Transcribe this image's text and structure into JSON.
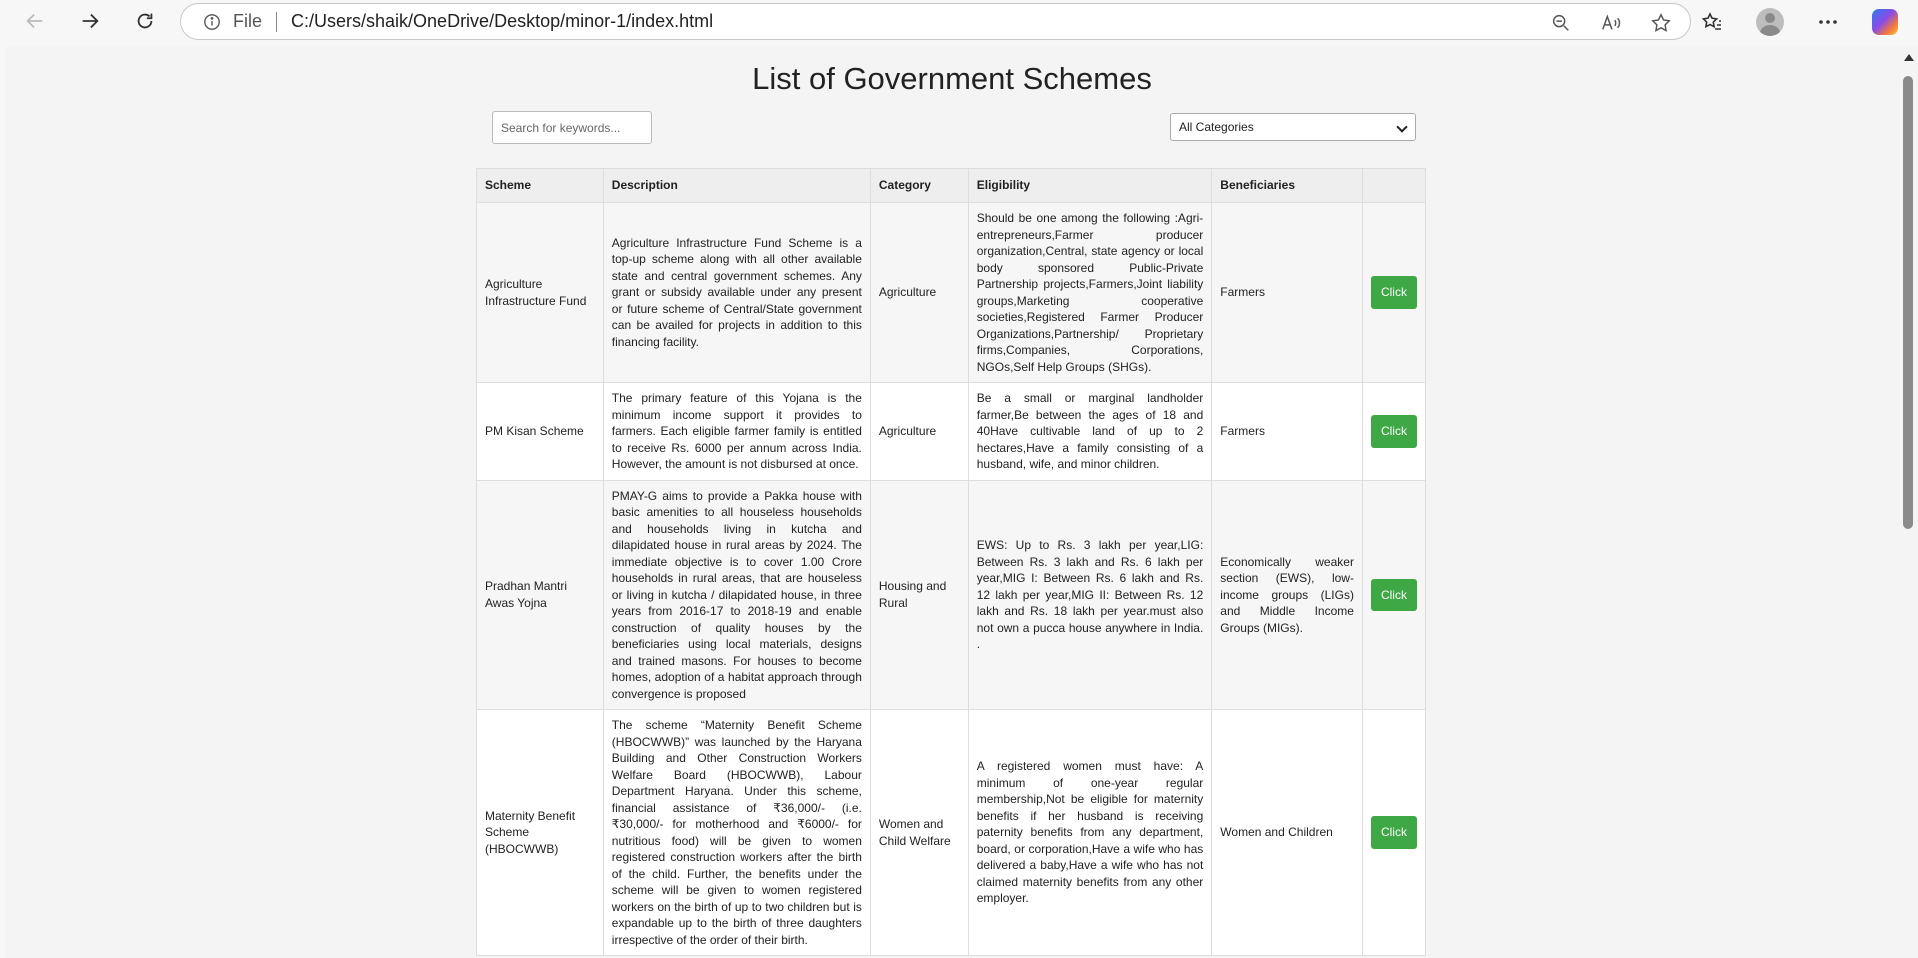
{
  "browser": {
    "file_label": "File",
    "url": "C:/Users/shaik/OneDrive/Desktop/minor-1/index.html"
  },
  "page": {
    "title": "List of Government Schemes",
    "search_placeholder": "Search for keywords...",
    "category_selected": "All Categories"
  },
  "table": {
    "headers": [
      "Scheme",
      "Description",
      "Category",
      "Eligibility",
      "Beneficiaries",
      ""
    ],
    "button_label": "Click",
    "rows": [
      {
        "scheme": "Agriculture Infrastructure Fund",
        "description": "Agriculture Infrastructure Fund Scheme is a top-up scheme along with all other available state and central government schemes. Any grant or subsidy available under any present or future scheme of Central/State government can be availed for projects in addition to this financing facility.",
        "category": "Agriculture",
        "eligibility": "Should be one among the following :Agri-entrepreneurs,Farmer producer organization,Central, state agency or local body sponsored Public-Private Partnership projects,Farmers,Joint liability groups,Marketing cooperative societies,Registered Farmer Producer Organizations,Partnership/ Proprietary firms,Companies, Corporations, NGOs,Self Help Groups (SHGs).",
        "beneficiaries": "Farmers"
      },
      {
        "scheme": "PM Kisan Scheme",
        "description": "The primary feature of this Yojana is the minimum income support it provides to farmers. Each eligible farmer family is entitled to receive Rs. 6000 per annum across India. However, the amount is not disbursed at once.",
        "category": "Agriculture",
        "eligibility": "Be a small or marginal landholder farmer,Be between the ages of 18 and 40Have cultivable land of up to 2 hectares,Have a family consisting of a husband, wife, and minor children.",
        "beneficiaries": "Farmers"
      },
      {
        "scheme": "Pradhan Mantri Awas Yojna",
        "description": "PMAY-G aims to provide a Pakka house with basic amenities to all houseless households and households living in kutcha and dilapidated house in rural areas by 2024. The immediate objective is to cover 1.00 Crore households in rural areas, that are houseless or living in kutcha / dilapidated house, in three years from 2016-17 to 2018-19 and enable construction of quality houses by the beneficiaries using local materials, designs and trained masons. For houses to become homes, adoption of a habitat approach through convergence is proposed",
        "category": "Housing and Rural",
        "eligibility": "EWS: Up to Rs. 3 lakh per year,LIG: Between Rs. 3 lakh and Rs. 6 lakh per year,MIG I: Between Rs. 6 lakh and Rs. 12 lakh per year,MIG II: Between Rs. 12 lakh and Rs. 18 lakh per year.must also not own a pucca house anywhere in India. .",
        "beneficiaries": "Economically weaker section (EWS), low-income groups (LIGs) and Middle Income Groups (MIGs)."
      },
      {
        "scheme": "Maternity Benefit Scheme (HBOCWWB)",
        "description": "The scheme “Maternity Benefit Scheme (HBOCWWB)” was launched by the Haryana Building and Other Construction Workers Welfare Board (HBOCWWB), Labour Department Haryana. Under this scheme, financial assistance of ₹36,000/- (i.e. ₹30,000/- for motherhood and ₹6000/- for nutritious food) will be given to women registered construction workers after the birth of the child. Further, the benefits under the scheme will be given to women registered workers on the birth of up to two children but is expandable up to the birth of three daughters irrespective of the order of their birth.",
        "category": "Women and Child Welfare",
        "eligibility": "A registered women must have: A minimum of one-year regular membership,Not be eligible for maternity benefits if her husband is receiving paternity benefits from any department, board, or corporation,Have a wife who has delivered a baby,Have a wife who has not claimed maternity benefits from any other employer.",
        "beneficiaries": "Women and Children"
      }
    ]
  }
}
